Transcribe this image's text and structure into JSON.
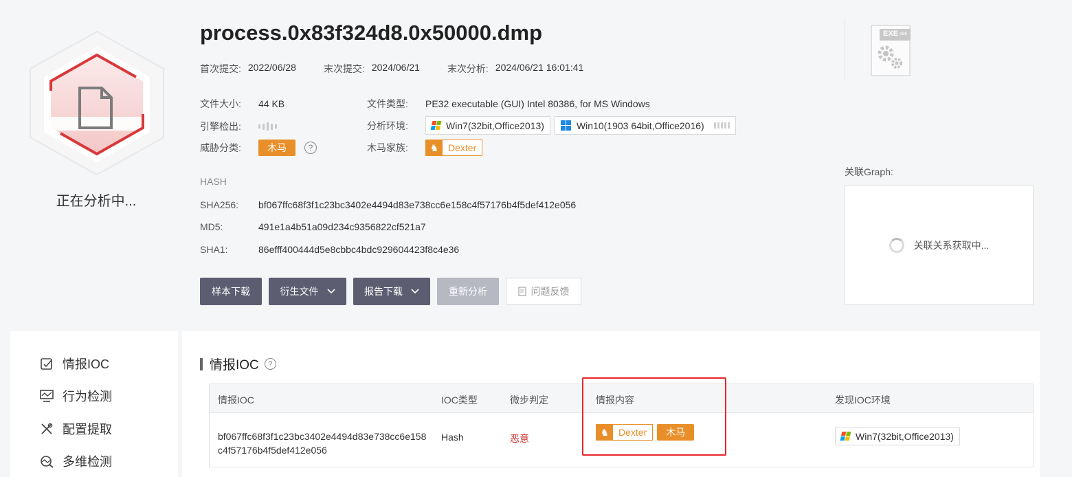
{
  "file": {
    "title": "process.0x83f324d8.0x50000.dmp",
    "status": "正在分析中..."
  },
  "dates": [
    {
      "label": "首次提交:",
      "value": "2022/06/28"
    },
    {
      "label": "末次提交:",
      "value": "2024/06/21"
    },
    {
      "label": "末次分析:",
      "value": "2024/06/21 16:01:41"
    }
  ],
  "info": {
    "size_label": "文件大小:",
    "size_value": "44 KB",
    "filetype_label": "文件类型:",
    "filetype_value": "PE32 executable (GUI) Intel 80386, for MS Windows",
    "engine_label": "引擎检出:",
    "env_label": "分析环境:",
    "envs": [
      "Win7(32bit,Office2013)",
      "Win10(1903 64bit,Office2016)"
    ],
    "threat_label": "威胁分类:",
    "threat_value": "木马",
    "family_label": "木马家族:",
    "family_value": "Dexter"
  },
  "hash": {
    "heading": "HASH",
    "sha256_label": "SHA256:",
    "sha256": "bf067ffc68f3f1c23bc3402e4494d83e738cc6e158c4f57176b4f5def412e056",
    "md5_label": "MD5:",
    "md5": "491e1a4b51a09d234c9356822cf521a7",
    "sha1_label": "SHA1:",
    "sha1": "86efff400444d5e8cbbc4bdc929604423f8c4e36"
  },
  "actions": {
    "download_sample": "样本下载",
    "derived_files": "衍生文件",
    "report_download": "报告下载",
    "reanalyze": "重新分析",
    "feedback": "问题反馈"
  },
  "exe_badge": "EXE",
  "exe_badge_sub": "x86",
  "graph": {
    "label": "关联Graph:",
    "loading": "关联关系获取中..."
  },
  "sidebar": {
    "items": [
      {
        "label": "情报IOC",
        "icon": "intel-ioc-icon"
      },
      {
        "label": "行为检测",
        "icon": "behavior-icon"
      },
      {
        "label": "配置提取",
        "icon": "config-icon"
      },
      {
        "label": "多维检测",
        "icon": "multi-detect-icon"
      }
    ]
  },
  "ioc": {
    "section_title": "情报IOC",
    "columns": [
      "情报IOC",
      "IOC类型",
      "微步判定",
      "情报内容",
      "发现IOC环境"
    ],
    "rows": [
      {
        "ioc": "bf067ffc68f3f1c23bc3402e4494d83e738cc6e158c4f57176b4f5def412e056",
        "type": "Hash",
        "verdict": "恶意",
        "family": "Dexter",
        "tag": "木马",
        "env": "Win7(32bit,Office2013)"
      }
    ]
  },
  "colors": {
    "accent_orange": "#e88f2a",
    "malicious_red": "#d0312d",
    "button_dark": "#5c5d70",
    "highlight_red": "#e8262b"
  }
}
